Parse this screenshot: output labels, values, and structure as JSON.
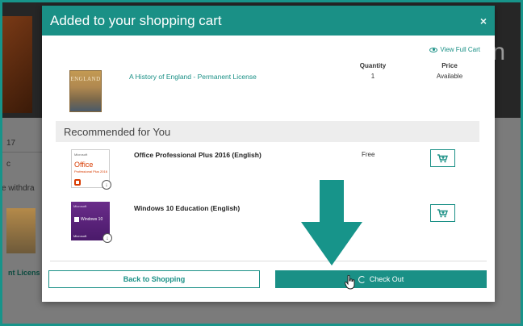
{
  "background": {
    "text_1": "17",
    "text_2": "c",
    "text_3": "e withdra",
    "link": "nt Licens"
  },
  "modal": {
    "title": "Added to your shopping cart",
    "close_label": "×",
    "view_full_cart": "View Full Cart",
    "columns": {
      "quantity": "Quantity",
      "price": "Price"
    },
    "cart_item": {
      "thumb_text": "ENGLAND",
      "name": "A History of England - Permanent License",
      "quantity": "1",
      "price": "Available"
    },
    "recommended_title": "Recommended for You",
    "recommended": [
      {
        "name": "Office Professional Plus 2016 (English)",
        "price": "Free",
        "thumb": {
          "brand": "Microsoft",
          "product": "Office",
          "sub": "Professional Plus 2016"
        }
      },
      {
        "name": "Windows 10 Education (English)",
        "price": "",
        "thumb": {
          "brand": "Microsoft",
          "product": "Windows 10",
          "footer": "Microsoft"
        }
      }
    ],
    "back_button": "Back to Shopping",
    "checkout_button": "Check Out"
  },
  "colors": {
    "accent": "#1a9086",
    "arrow": "#17948a"
  },
  "icons": [
    "eye-icon",
    "close-icon",
    "cart-add-icon",
    "download-icon",
    "spinner-icon",
    "pointer-cursor-icon",
    "down-arrow-icon"
  ]
}
